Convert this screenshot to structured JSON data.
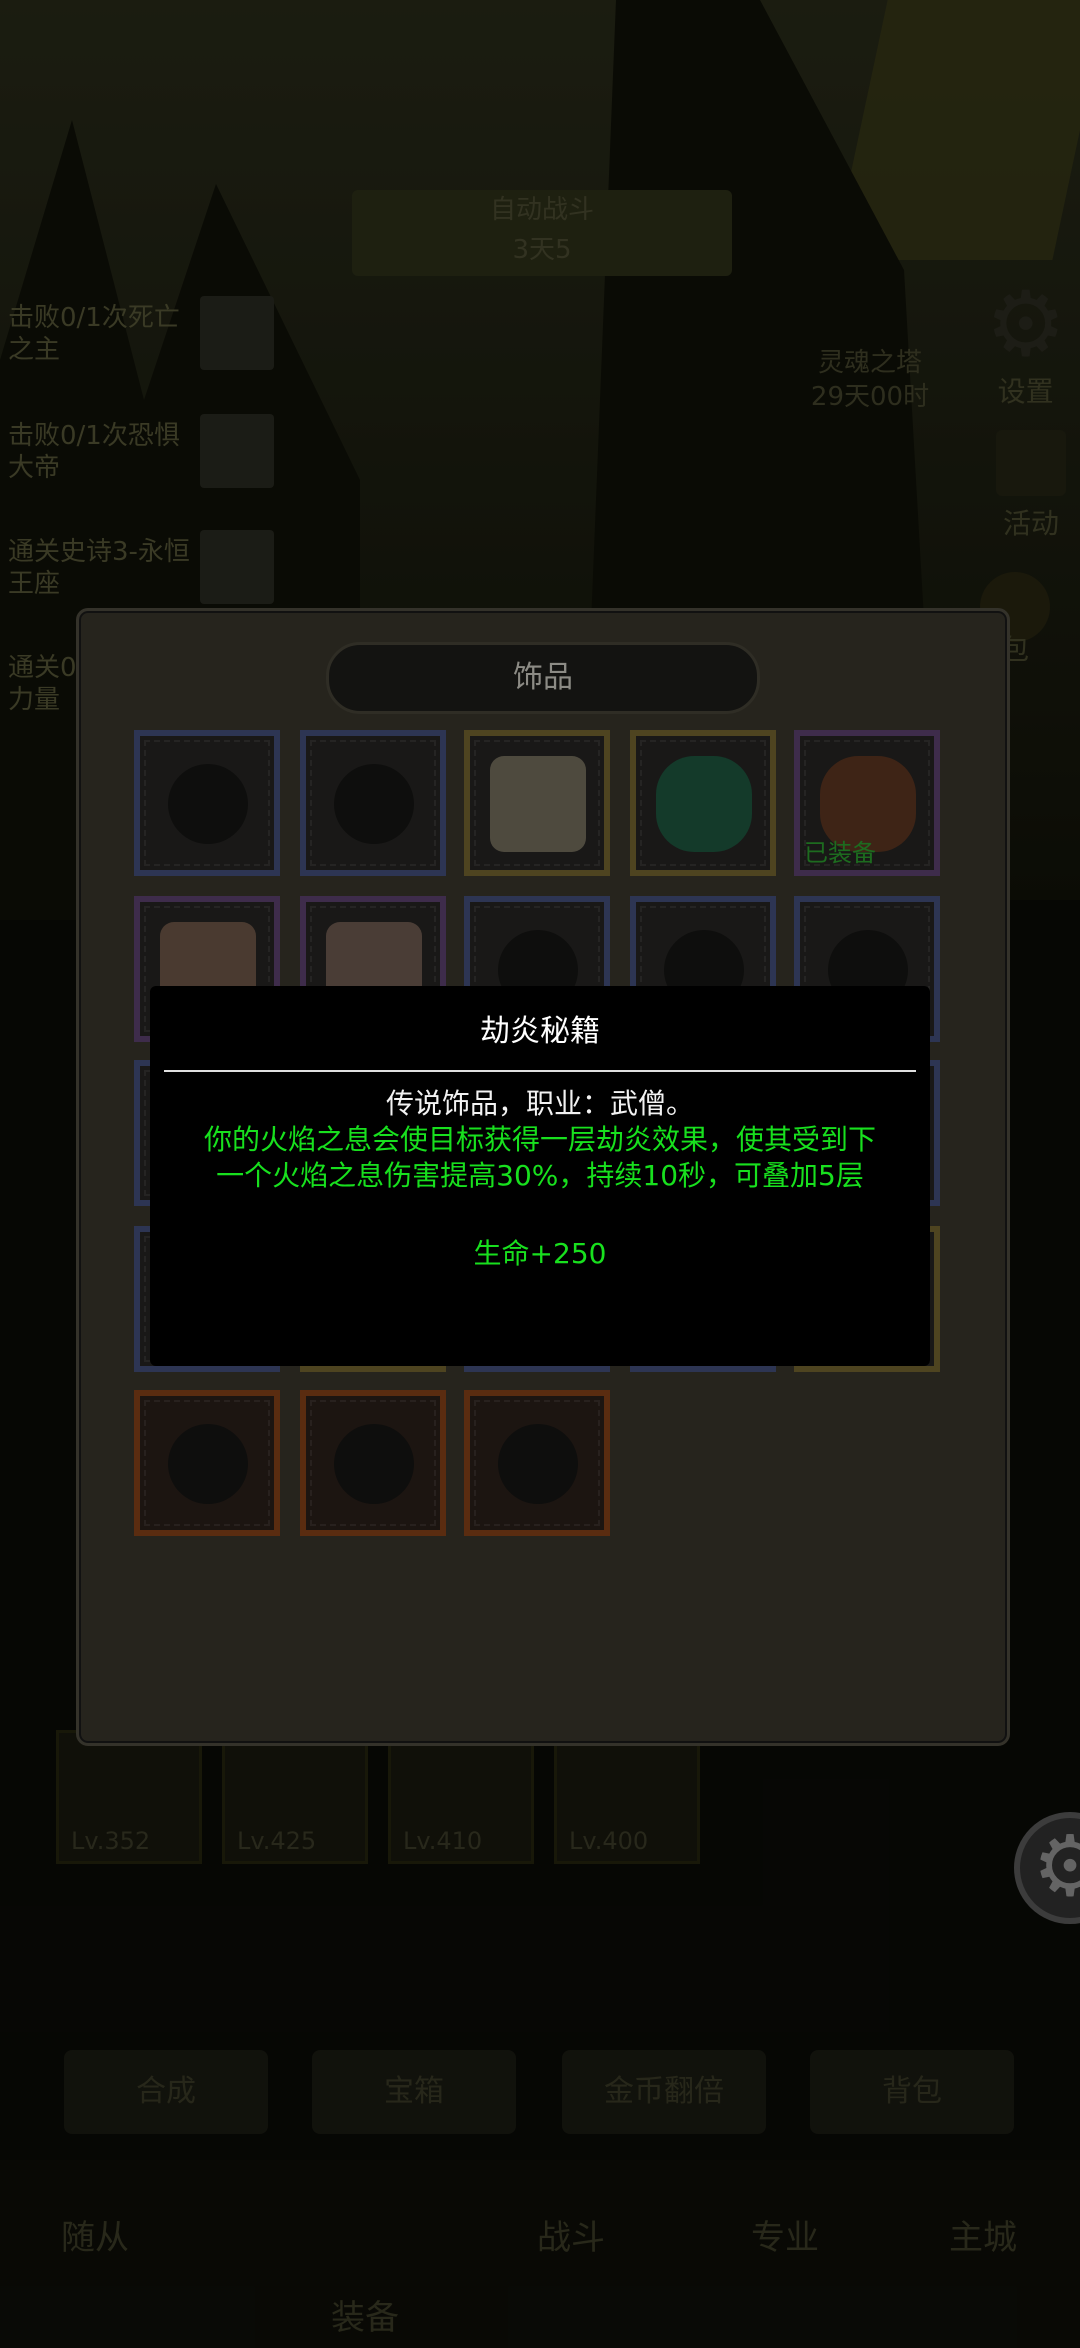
{
  "background": {
    "top_banner": {
      "line1": "自动战斗",
      "line2": "3天5"
    },
    "quests": [
      {
        "text": "击败0/1次死亡之主"
      },
      {
        "text": "击败0/1次恐惧大帝"
      },
      {
        "text": "通关史诗3-永恒王座"
      },
      {
        "text": "通关0力量"
      }
    ],
    "tower": {
      "name": "灵魂之塔",
      "time": "29天00时"
    },
    "right_buttons": [
      "设置",
      "活动",
      "包"
    ],
    "levels": [
      "Lv.352",
      "Lv.425",
      "Lv.410",
      "Lv.400"
    ],
    "action_buttons": [
      "合成",
      "宝箱",
      "金币翻倍",
      "背包"
    ],
    "nav": [
      "随从",
      "装备",
      "战斗",
      "专业",
      "主城"
    ]
  },
  "panel": {
    "title": "饰品",
    "equipped_label": "已装备"
  },
  "tooltip": {
    "name": "劫炎秘籍",
    "subtitle": "传说饰品，职业：武僧。",
    "description": "你的火焰之息会使目标获得一层劫炎效果，使其受到下一个火焰之息伤害提高30%，持续10秒，可叠加5层",
    "stat": "生命+250"
  },
  "colors": {
    "panel_bg": "#26241d",
    "tooltip_desc": "#18e01e",
    "rarity_blue": "#2d3553",
    "rarity_gold": "#4e4420",
    "rarity_purple": "#3e2c4b",
    "rarity_orange": "#5a2c10"
  }
}
